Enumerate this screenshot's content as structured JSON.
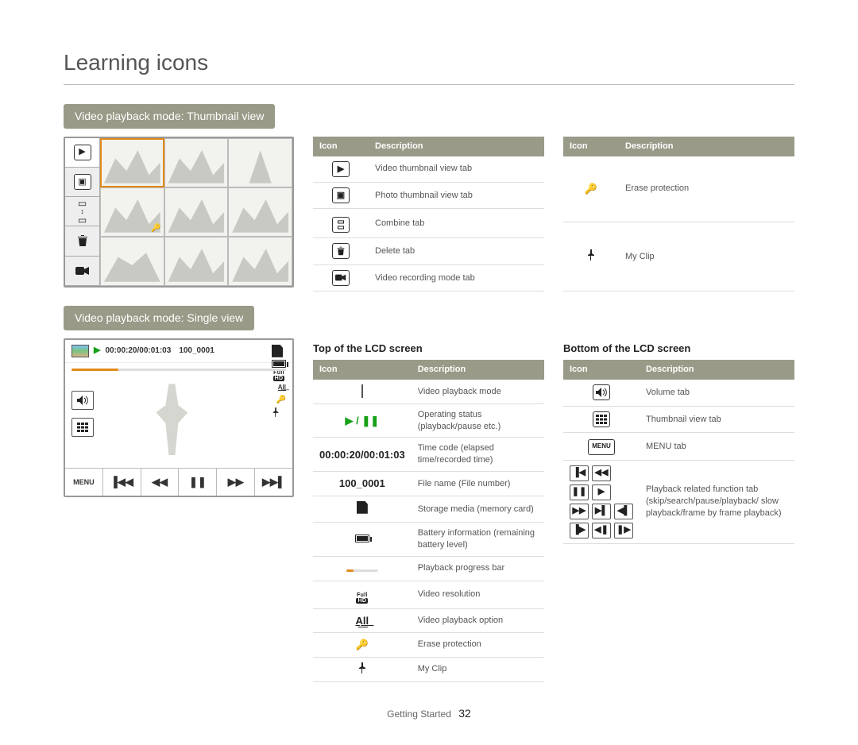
{
  "page_title": "Learning icons",
  "section_thumb_title": "Video playback mode: Thumbnail view",
  "section_single_title": "Video playback mode: Single view",
  "subhead_top": "Top of the LCD screen",
  "subhead_bottom": "Bottom of the LCD screen",
  "headers": {
    "icon": "Icon",
    "desc": "Description"
  },
  "thumb_left_table": [
    {
      "icon": "video-tab",
      "desc": "Video thumbnail view tab"
    },
    {
      "icon": "photo-tab",
      "desc": "Photo thumbnail view tab"
    },
    {
      "icon": "combine-tab",
      "desc": "Combine tab"
    },
    {
      "icon": "delete-tab",
      "desc": "Delete tab"
    },
    {
      "icon": "record-tab",
      "desc": "Video recording mode tab"
    }
  ],
  "thumb_right_table": [
    {
      "icon": "key",
      "desc": "Erase protection"
    },
    {
      "icon": "pin",
      "desc": "My Clip"
    }
  ],
  "single_timecode": "00:00:20/00:01:03",
  "single_filename": "100_0001",
  "top_table": [
    {
      "icon": "landscape",
      "desc": "Video playback mode"
    },
    {
      "icon": "playpause",
      "label": "▶ / ❚❚",
      "desc": "Operating status (playback/pause etc.)"
    },
    {
      "icon": "text",
      "label": "00:00:20/00:01:03",
      "desc": "Time code (elapsed time/recorded time)"
    },
    {
      "icon": "text",
      "label": "100_0001",
      "desc": "File name (File number)"
    },
    {
      "icon": "card",
      "desc": "Storage media (memory card)"
    },
    {
      "icon": "battery",
      "desc": "Battery information (remaining battery level)"
    },
    {
      "icon": "progress",
      "desc": "Playback progress bar"
    },
    {
      "icon": "fullhd",
      "desc": "Video resolution"
    },
    {
      "icon": "all",
      "label": "A͟l͟l͟",
      "desc": "Video playback option"
    },
    {
      "icon": "key",
      "desc": "Erase protection"
    },
    {
      "icon": "pin",
      "desc": "My Clip"
    }
  ],
  "bottom_table": [
    {
      "icon": "volume",
      "desc": "Volume tab"
    },
    {
      "icon": "thumbtab",
      "desc": "Thumbnail view tab"
    },
    {
      "icon": "menu",
      "label": "MENU",
      "desc": "MENU tab"
    },
    {
      "icon": "transport",
      "desc": "Playback related function tab (skip/search/pause/playback/ slow playback/frame by frame playback)"
    }
  ],
  "menu_label": "MENU",
  "all_label": "A͟l͟l͟",
  "fullhd_top": "Full",
  "fullhd_bot": "HD",
  "footer_section": "Getting Started",
  "footer_page": "32"
}
